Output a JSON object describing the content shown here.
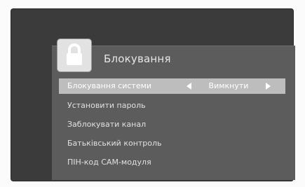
{
  "menu": {
    "title": "Блокування",
    "title_icon": "lock-icon",
    "items": [
      {
        "label": "Блокування системи",
        "value": "Вимкнути",
        "selected": true
      },
      {
        "label": "Установити пароль"
      },
      {
        "label": "Заблокувати канал"
      },
      {
        "label": "Батьківський контроль"
      },
      {
        "label": "ПІН-код CAM-модуля"
      }
    ]
  },
  "colors": {
    "screen_bg": "#3b3b3b",
    "panel_bg": "#5c5c5c",
    "highlight_bg": "#bdbdbd",
    "text": "#e0e0e0"
  }
}
